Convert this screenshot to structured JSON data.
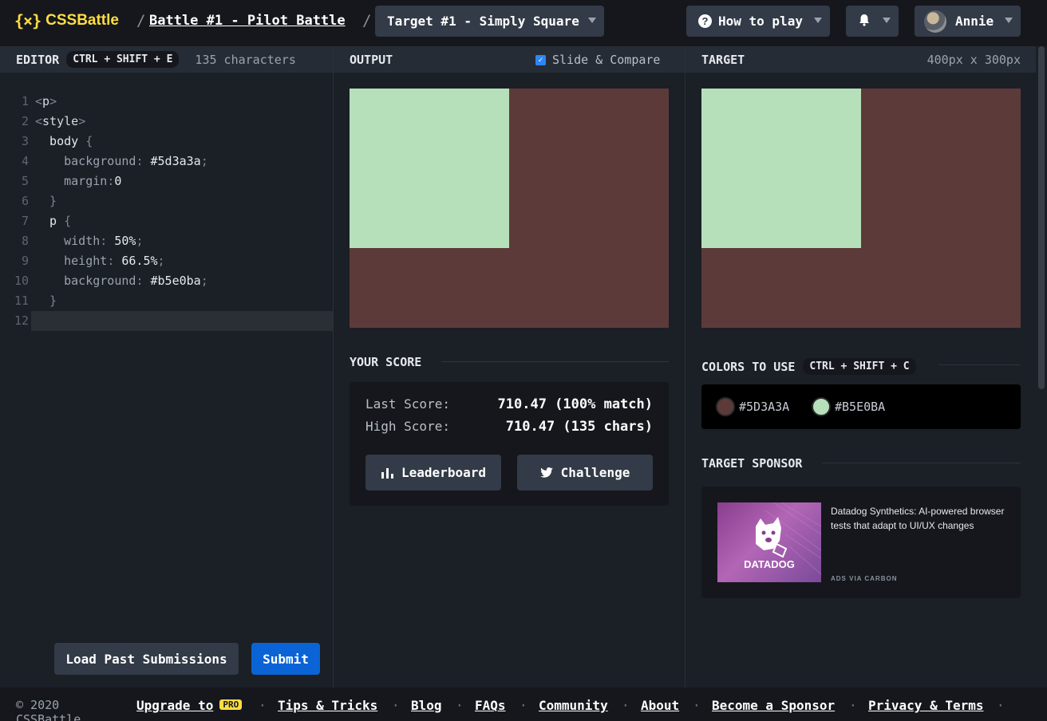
{
  "header": {
    "logo_mark": "{×}",
    "logo_text": "CSSBattle",
    "separator": "/",
    "battle_link": "Battle #1 - Pilot Battle",
    "target_select": "Target #1 - Simply Square",
    "how_to_play": "How to play",
    "help_icon": "?",
    "bell_icon": "🔔",
    "user_name": "Annie"
  },
  "editor": {
    "title": "EDITOR",
    "shortcut": "CTRL + SHIFT + E",
    "char_count": "135 characters",
    "lines": [
      {
        "n": "1",
        "segments": [
          [
            "c-punct",
            "<"
          ],
          [
            "c-tag",
            "p"
          ],
          [
            "c-punct",
            ">"
          ]
        ]
      },
      {
        "n": "2",
        "segments": [
          [
            "c-punct",
            "<"
          ],
          [
            "c-tag",
            "style"
          ],
          [
            "c-punct",
            ">"
          ]
        ]
      },
      {
        "n": "3",
        "segments": [
          [
            "c-sel",
            "  body "
          ],
          [
            "c-punct",
            "{"
          ]
        ]
      },
      {
        "n": "4",
        "segments": [
          [
            "c-prop",
            "    background"
          ],
          [
            "c-punct",
            ": "
          ],
          [
            "c-val",
            "#5d3a3a"
          ],
          [
            "c-punct",
            ";"
          ]
        ]
      },
      {
        "n": "5",
        "segments": [
          [
            "c-prop",
            "    margin"
          ],
          [
            "c-punct",
            ":"
          ],
          [
            "c-val",
            "0"
          ]
        ]
      },
      {
        "n": "6",
        "segments": [
          [
            "c-punct",
            "  }"
          ]
        ]
      },
      {
        "n": "7",
        "segments": [
          [
            "c-sel",
            "  p "
          ],
          [
            "c-punct",
            "{"
          ]
        ]
      },
      {
        "n": "8",
        "segments": [
          [
            "c-prop",
            "    width"
          ],
          [
            "c-punct",
            ": "
          ],
          [
            "c-val",
            "50%"
          ],
          [
            "c-punct",
            ";"
          ]
        ]
      },
      {
        "n": "9",
        "segments": [
          [
            "c-prop",
            "    height"
          ],
          [
            "c-punct",
            ": "
          ],
          [
            "c-val",
            "66.5%"
          ],
          [
            "c-punct",
            ";"
          ]
        ]
      },
      {
        "n": "10",
        "segments": [
          [
            "c-prop",
            "    background"
          ],
          [
            "c-punct",
            ": "
          ],
          [
            "c-val",
            "#b5e0ba"
          ],
          [
            "c-punct",
            ";"
          ]
        ]
      },
      {
        "n": "11",
        "segments": [
          [
            "c-punct",
            "  }"
          ]
        ]
      },
      {
        "n": "12",
        "segments": []
      }
    ],
    "load_past": "Load Past Submissions",
    "submit": "Submit"
  },
  "output": {
    "title": "OUTPUT",
    "slide_compare": "Slide & Compare",
    "slide_checked": true
  },
  "target": {
    "title": "TARGET",
    "size": "400px x 300px"
  },
  "score": {
    "title": "YOUR SCORE",
    "last_label": "Last Score:",
    "last_value": "710.47 (100% match)",
    "high_label": "High Score:",
    "high_value": "710.47 (135 chars)",
    "leaderboard": "Leaderboard",
    "challenge": "Challenge"
  },
  "colors": {
    "title": "COLORS TO USE",
    "shortcut": "CTRL + SHIFT + C",
    "items": [
      {
        "hex": "#5D3A3A",
        "color": "#5d3a3a"
      },
      {
        "hex": "#B5E0BA",
        "color": "#b5e0ba"
      }
    ]
  },
  "sponsor": {
    "title": "TARGET SPONSOR",
    "ad_brand": "DATADOG",
    "ad_text": "Datadog Synthetics: AI-powered browser tests that adapt to UI/UX changes",
    "ad_via": "ADS VIA CARBON"
  },
  "footer": {
    "copyright": "© 2020 CSSBattle",
    "upgrade": "Upgrade to",
    "pro": "PRO",
    "tips": "Tips & Tricks",
    "blog": "Blog",
    "faqs": "FAQs",
    "community": "Community",
    "about": "About",
    "sponsor": "Become a Sponsor",
    "privacy": "Privacy & Terms",
    "separator": "·"
  },
  "theme": {
    "accent": "#ffdd40",
    "submit_blue": "#0a64d6",
    "canvas_bg": "#5d3a3a",
    "square": "#b5e0ba"
  }
}
